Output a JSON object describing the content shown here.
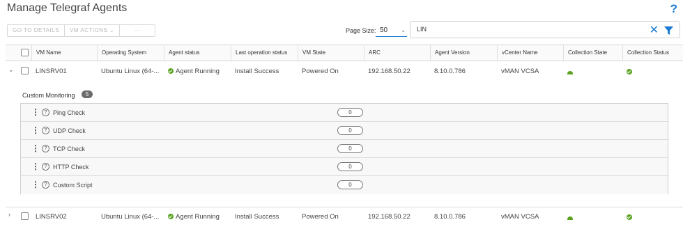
{
  "page": {
    "title": "Manage Telegraf Agents",
    "help_symbol": "?"
  },
  "toolbar": {
    "go_to_details": "GO TO DETAILS",
    "vm_actions": "VM ACTIONS ⌄",
    "more": "···"
  },
  "paging": {
    "label": "Page Size:",
    "value": "50"
  },
  "search": {
    "value": "LIN"
  },
  "columns": [
    "VM Name",
    "Operating System",
    "Agent status",
    "Last operation status",
    "VM State",
    "ARC",
    "Agent Version",
    "vCenter Name",
    "Collection State",
    "Collection Status"
  ],
  "rows": [
    {
      "vm_name": "LINSRV01",
      "os": "Ubuntu Linux (64-...",
      "agent_status": "Agent Running",
      "last_op": "Install Success",
      "vm_state": "Powered On",
      "arc": "192.168.50.22",
      "agent_version": "8.10.0.786",
      "vcenter": "vMAN VCSA",
      "expanded": true
    },
    {
      "vm_name": "LINSRV02",
      "os": "Ubuntu Linux (64-...",
      "agent_status": "Agent Running",
      "last_op": "Install Success",
      "vm_state": "Powered On",
      "arc": "192.168.50.22",
      "agent_version": "8.10.0.786",
      "vcenter": "vMAN VCSA",
      "expanded": false
    }
  ],
  "custom_monitoring": {
    "title": "Custom Monitoring",
    "count": "5",
    "items": [
      {
        "name": "Ping Check",
        "value": "0"
      },
      {
        "name": "UDP Check",
        "value": "0"
      },
      {
        "name": "TCP Check",
        "value": "0"
      },
      {
        "name": "HTTP Check",
        "value": "0"
      },
      {
        "name": "Custom Script",
        "value": "0"
      }
    ]
  },
  "colors": {
    "accent": "#1a7ad4",
    "status_green": "#5aa220"
  }
}
